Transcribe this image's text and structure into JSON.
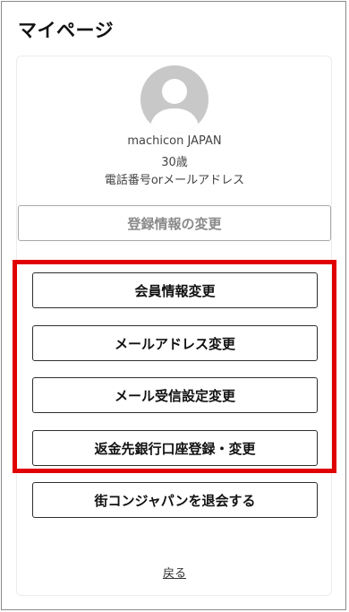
{
  "page": {
    "title": "マイページ"
  },
  "profile": {
    "avatar_icon": "user-avatar-icon",
    "name": "machicon JAPAN",
    "age": "30歳",
    "contact": "電話番号orメールアドレス"
  },
  "edit_button": {
    "label": "登録情報の変更"
  },
  "menu": {
    "member_info": "会員情報変更",
    "email": "メールアドレス変更",
    "mail_settings": "メール受信設定変更",
    "refund_account": "返金先銀行口座登録・変更",
    "withdraw": "街コンジャパンを退会する"
  },
  "back_link": {
    "label": "戻る"
  },
  "colors": {
    "highlight": "#e00000",
    "avatar": "#c8c8c8",
    "muted_button_text": "#8a8a8a"
  }
}
